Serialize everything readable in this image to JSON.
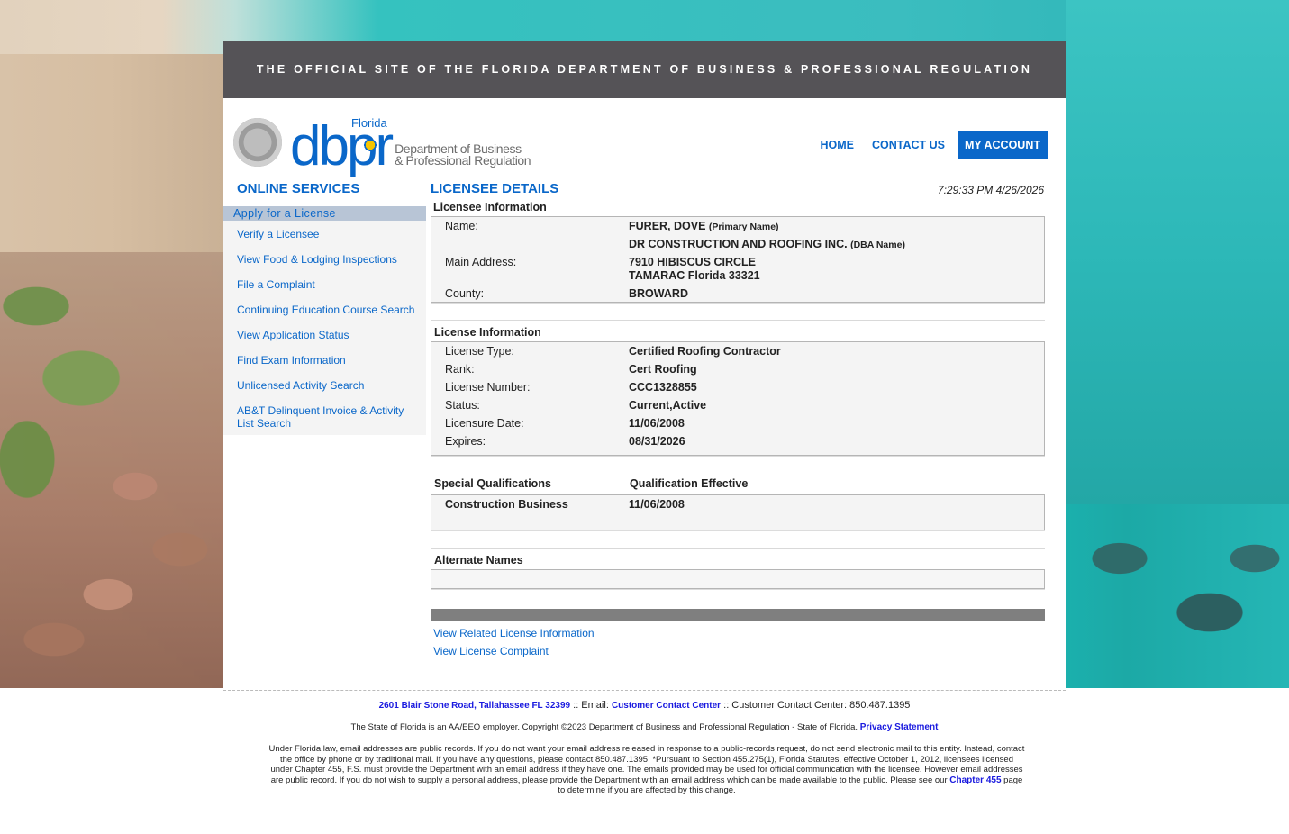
{
  "banner": "THE OFFICIAL SITE OF THE FLORIDA DEPARTMENT OF BUSINESS & PROFESSIONAL REGULATION",
  "logo": {
    "florida": "Florida",
    "dbpr": "dbpr",
    "dept_line1": "Department of Business",
    "dept_line2": "& Professional Regulation"
  },
  "nav": {
    "home": "HOME",
    "contact": "CONTACT US",
    "account": "MY ACCOUNT"
  },
  "sidebar": {
    "title": "ONLINE SERVICES",
    "active": "Apply for a License",
    "items": [
      "Verify a Licensee",
      "View Food & Lodging Inspections",
      "File a Complaint",
      "Continuing Education Course Search",
      "View Application Status",
      "Find Exam Information",
      "Unlicensed Activity Search",
      "AB&T Delinquent Invoice & Activity List Search"
    ]
  },
  "details": {
    "title": "LICENSEE DETAILS",
    "timestamp": "7:29:33 PM 4/26/2026",
    "licensee": {
      "section": "Licensee Information",
      "name_label": "Name:",
      "name": "FURER, DOVE",
      "name_tag": "(Primary Name)",
      "dba": "DR CONSTRUCTION AND ROOFING INC.",
      "dba_tag": "(DBA Name)",
      "address_label": "Main Address:",
      "address1": "7910 HIBISCUS CIRCLE",
      "address2": "TAMARAC  Florida  33321",
      "county_label": "County:",
      "county": "BROWARD"
    },
    "license": {
      "section": "License Information",
      "rows": [
        {
          "label": "License Type:",
          "value": "Certified Roofing Contractor"
        },
        {
          "label": "Rank:",
          "value": "Cert Roofing"
        },
        {
          "label": "License Number:",
          "value": "CCC1328855"
        },
        {
          "label": "Status:",
          "value": "Current,Active"
        },
        {
          "label": "Licensure Date:",
          "value": "11/06/2008"
        },
        {
          "label": "Expires:",
          "value": "08/31/2026"
        }
      ]
    },
    "qualifications": {
      "header_left": "Special Qualifications",
      "header_right": "Qualification Effective",
      "name": "Construction Business",
      "date": "11/06/2008"
    },
    "alternate_names": "Alternate Names",
    "links": {
      "related": "View Related License Information",
      "complaint": "View License Complaint"
    }
  },
  "footer": {
    "address": "2601 Blair Stone Road, Tallahassee FL 32399",
    "email_prefix": ":: Email:",
    "email_link": "Customer Contact Center",
    "contact_center": ":: Customer Contact Center: 850.487.1395",
    "employer": "The State of Florida is an AA/EEO employer. Copyright ©2023 Department of Business and Professional Regulation - State of Florida.",
    "privacy": "Privacy Statement",
    "notice": "Under Florida law, email addresses are public records. If you do not want your email address released in response to a public-records request, do not send electronic mail to this entity. Instead, contact the office by phone or by traditional mail. If you have any questions, please contact 850.487.1395. *Pursuant to Section 455.275(1), Florida Statutes, effective October 1, 2012, licensees licensed under Chapter 455, F.S. must provide the Department with an email address if they have one. The emails provided may be used for official communication with the licensee. However email addresses are public record. If you do not wish to supply a personal address, please provide the Department with an email address which can be made available to the public. Please see our",
    "chapter_link": "Chapter 455",
    "notice_end": "page to determine if you are affected by this change."
  }
}
